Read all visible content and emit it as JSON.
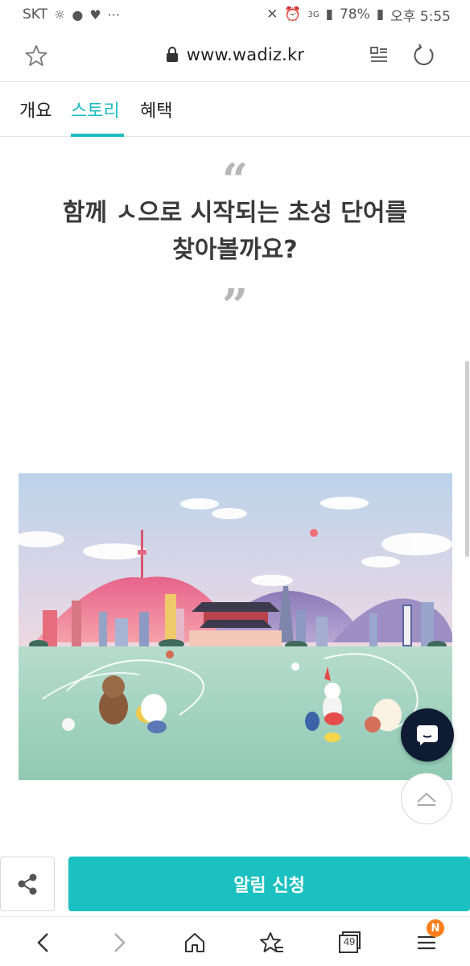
{
  "status_bar": {
    "carrier": "SKT",
    "battery": "78%",
    "time": "오후 5:55",
    "network": "3G"
  },
  "url_bar": {
    "url": "www.wadiz.kr"
  },
  "tabs": [
    {
      "label": "개요",
      "active": false
    },
    {
      "label": "스토리",
      "active": true
    },
    {
      "label": "혜택",
      "active": false
    }
  ],
  "quote": {
    "open_mark": "“",
    "line1": "함께 ㅅ으로 시작되는 초성 단어를",
    "line2": "찾아볼까요?",
    "close_mark": "”"
  },
  "actions": {
    "notify_label": "알림 신청"
  },
  "nav": {
    "tab_count": "49",
    "menu_badge": "N"
  },
  "colors": {
    "accent": "#1cbcc1",
    "button": "#1bc1c1",
    "chat_fab": "#0f1b33",
    "badge": "#ff7f1d"
  },
  "icons": {
    "share": "share-icon",
    "chat": "chat-icon",
    "scroll_top": "chevron-up-icon"
  }
}
